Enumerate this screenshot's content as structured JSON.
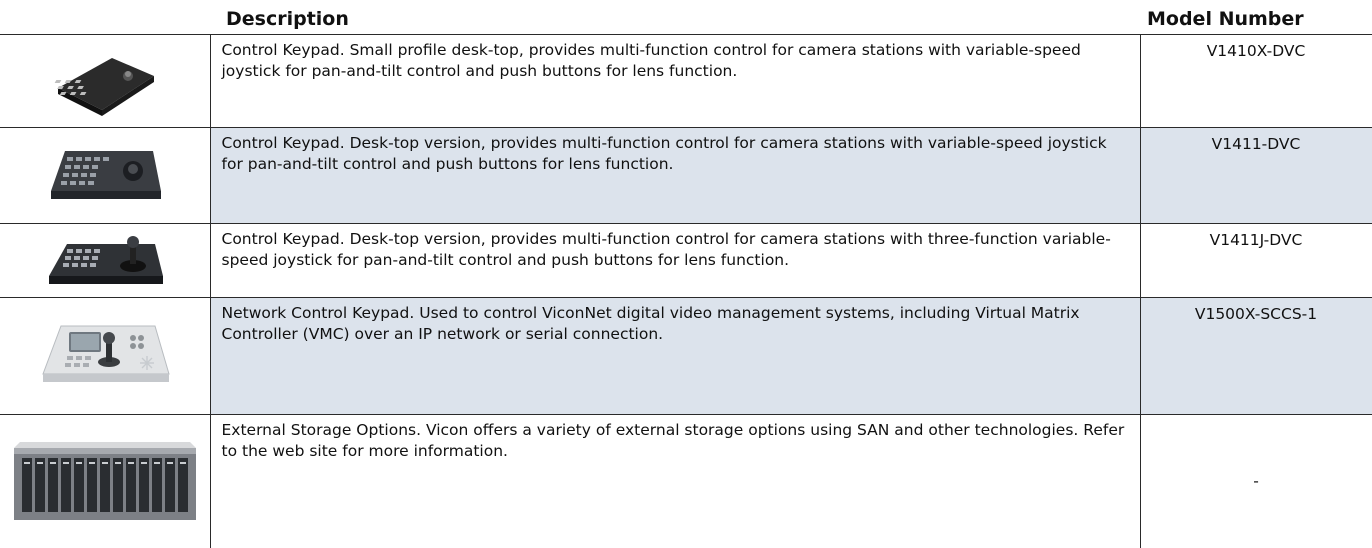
{
  "header": {
    "description_label": "Description",
    "model_label": "Model Number"
  },
  "rows": [
    {
      "image_icon": "desktop-keypad-small-icon",
      "description": "Control Keypad. Small profile desk-top, provides multi-function control for camera stations with variable-speed joystick for pan-and-tilt control and push buttons for lens function.",
      "model": "V1410X-DVC",
      "shaded": false
    },
    {
      "image_icon": "desktop-keypad-icon",
      "description": "Control Keypad. Desk-top version, provides multi-function control for camera stations with variable-speed joystick for pan-and-tilt control and push buttons for lens function.",
      "model": "V1411-DVC",
      "shaded": true
    },
    {
      "image_icon": "desktop-keypad-joystick-icon",
      "description": "Control Keypad. Desk-top version, provides multi-function control for camera stations with three-function variable-speed joystick for pan-and-tilt control and push buttons for lens function.",
      "model": "V1411J-DVC",
      "shaded": false
    },
    {
      "image_icon": "network-keypad-icon",
      "description": "Network Control Keypad. Used to control ViconNet digital video management systems, including Virtual Matrix Controller (VMC) over an IP network or serial connection.",
      "model": "V1500X-SCCS-1",
      "shaded": true
    },
    {
      "image_icon": "storage-array-icon",
      "description": "External Storage Options. Vicon offers a variety of external storage options using SAN and other technologies. Refer to the web site for more information.",
      "model": "-",
      "shaded": false
    }
  ]
}
